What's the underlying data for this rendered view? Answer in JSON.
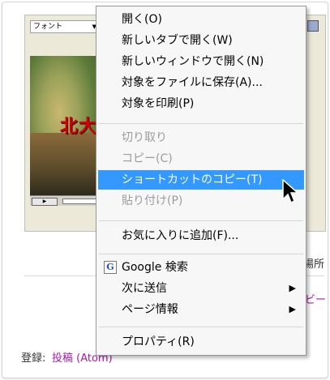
{
  "background_page": {
    "font_dropdown": "フォント",
    "photo_caption": "北大",
    "side_text_right": "場所",
    "side_link_right": "ビー",
    "footer": {
      "label": "登録:",
      "link": "投稿 (Atom)"
    }
  },
  "context_menu": {
    "items": [
      {
        "label": "開く(O)",
        "state": "enabled"
      },
      {
        "label": "新しいタブで開く(W)",
        "state": "enabled"
      },
      {
        "label": "新しいウィンドウで開く(N)",
        "state": "enabled"
      },
      {
        "label": "対象をファイルに保存(A)...",
        "state": "enabled"
      },
      {
        "label": "対象を印刷(P)",
        "state": "enabled"
      },
      {
        "label": "切り取り",
        "state": "disabled"
      },
      {
        "label": "コピー(C)",
        "state": "disabled"
      },
      {
        "label": "ショートカットのコピー(T)",
        "state": "highlighted"
      },
      {
        "label": "貼り付け(P)",
        "state": "disabled"
      },
      {
        "label": "お気に入りに追加(F)...",
        "state": "enabled"
      },
      {
        "label": "Google 検索",
        "state": "enabled",
        "icon": "google-g-icon"
      },
      {
        "label": "次に送信",
        "state": "enabled",
        "submenu": true
      },
      {
        "label": "ページ情報",
        "state": "enabled",
        "submenu": true
      },
      {
        "label": "プロパティ(R)",
        "state": "enabled"
      }
    ],
    "submenu_arrow": "▶",
    "google_icon_glyph": "G",
    "highlight_color": "#3399ff"
  }
}
